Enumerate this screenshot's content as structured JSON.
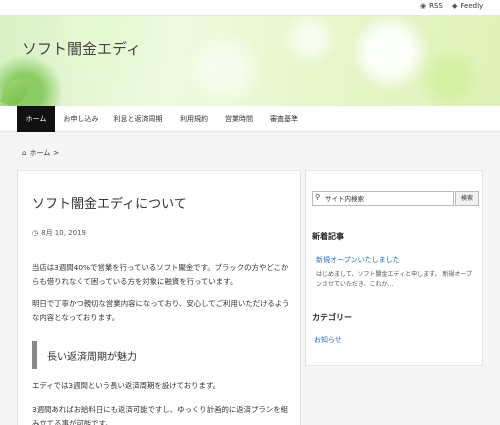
{
  "topbar": {
    "rss_label": "RSS",
    "feedly_label": "Feedly",
    "rss_icon": "rss-icon",
    "feedly_icon": "feedly-icon"
  },
  "header": {
    "site_title": "ソフト闇金エディ"
  },
  "nav": {
    "items": [
      {
        "label": "ホーム",
        "active": true
      },
      {
        "label": "お申し込み"
      },
      {
        "label": "利息と返済周期"
      },
      {
        "label": "利用規約"
      },
      {
        "label": "営業時間"
      },
      {
        "label": "審査基準"
      }
    ]
  },
  "breadcrumb": {
    "home_label": "ホーム",
    "separator": ">",
    "home_icon": "home-icon"
  },
  "post": {
    "title": "ソフト闇金エディについて",
    "date": "8月 10, 2019",
    "date_icon": "clock-icon",
    "paragraphs": [
      "当店は3週間40%で営業を行っているソフト闇金です。ブラックの方やどこからも借りれなくて困っている方を対象に融資を行っています。",
      "明日で丁寧かつ親切な営業内容になっており、安心してご利用いただけるような内容となっております。",
      "エディでは3週間という長い返済周期を設けております。",
      "3週間あればお給料日にも返済可能ですし、ゆっくり計画的に返済プランを組み立てる事が可能です。"
    ],
    "h2": "長い返済周期が魅力"
  },
  "sidebar": {
    "search_placeholder": "サイト内検索",
    "search_button": "検索",
    "search_icon": "search-icon",
    "recent_heading": "新着記事",
    "recent_title": "新規オープンいたしました",
    "recent_excerpt": "はじめまして、ソフト闇金エディと申します。 新規オープンさせていただき、これか…",
    "category_heading": "カテゴリー",
    "category_link": "お知らせ"
  }
}
